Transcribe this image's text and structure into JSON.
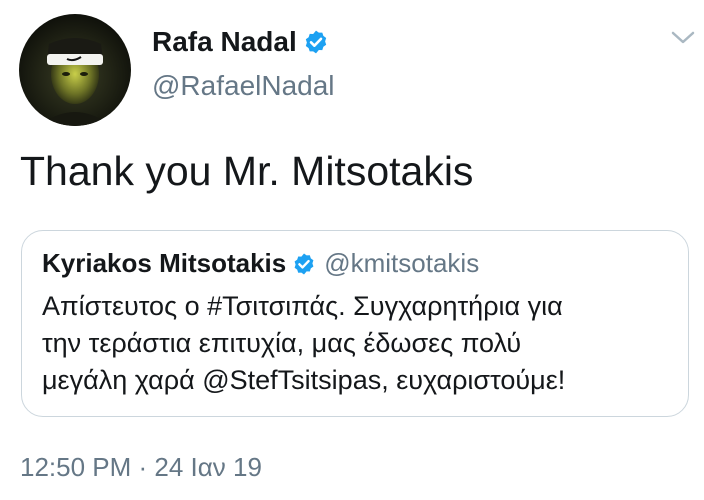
{
  "author": {
    "display_name": "Rafa Nadal",
    "handle": "@RafaelNadal",
    "verified": true
  },
  "tweet": {
    "text": "Thank you Mr. Mitsotakis",
    "timestamp": "12:50 PM · 24 Ιαν 19"
  },
  "quoted_tweet": {
    "display_name": "Kyriakos Mitsotakis",
    "handle": "@kmitsotakis",
    "verified": true,
    "lines": [
      "Απίστευτος ο #Τσιτσιπάς. Συγχαρητήρια για",
      "την τεράστια επιτυχία, μας έδωσες πολύ",
      "μεγάλη χαρά @StefTsitsipas, ευχαριστούμε!"
    ]
  },
  "icons": {
    "verified": "verified-badge-icon",
    "menu": "chevron-down-icon"
  },
  "colors": {
    "verified_blue": "#1da1f2",
    "secondary_text": "#657786",
    "border": "#ccd6dd"
  }
}
